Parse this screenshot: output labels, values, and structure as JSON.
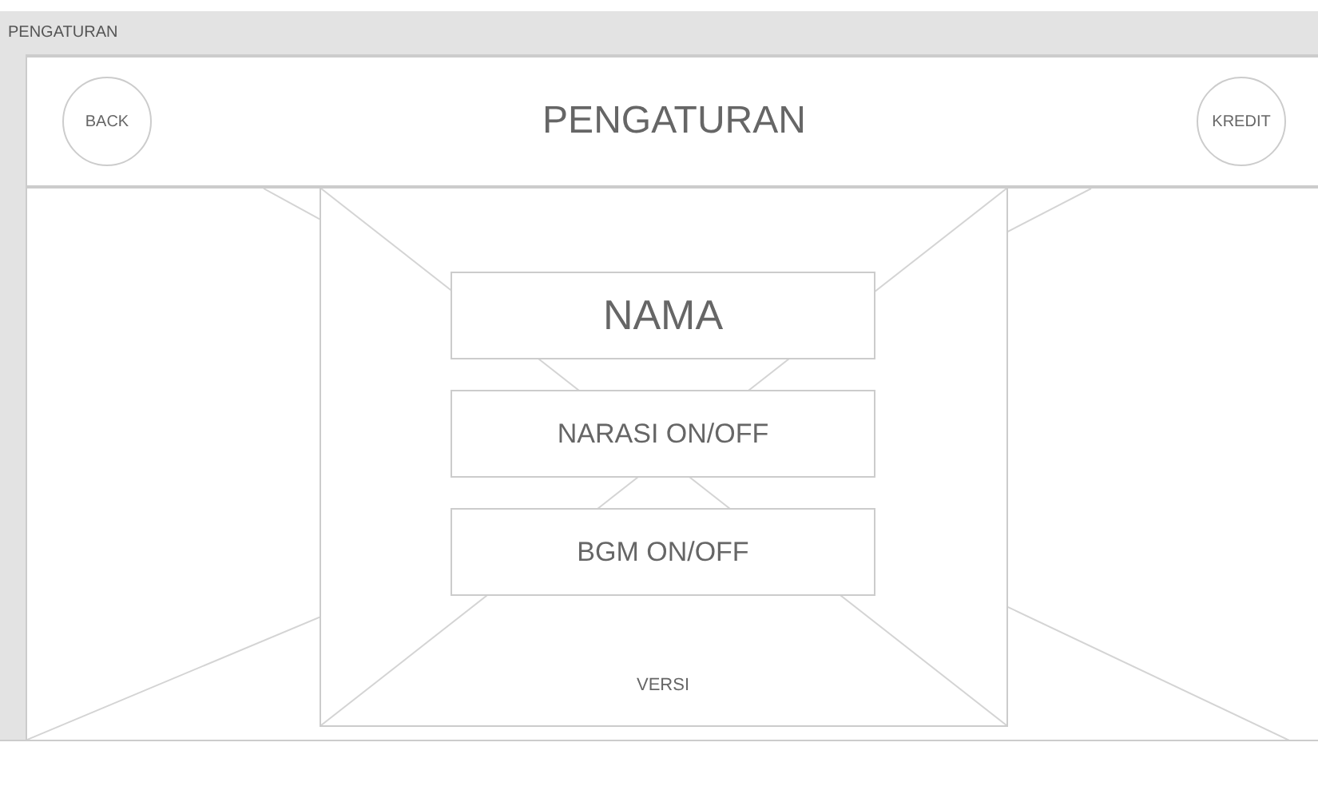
{
  "window": {
    "title": "PENGATURAN"
  },
  "header": {
    "back_button": "BACK",
    "title": "PENGATURAN",
    "credit_button": "KREDIT"
  },
  "menu_buttons": [
    {
      "label": "NAMA",
      "kind": "large"
    },
    {
      "label": "NARASI ON/OFF",
      "kind": "normal"
    },
    {
      "label": "BGM ON/OFF",
      "kind": "normal"
    }
  ],
  "version_label": "VERSI"
}
